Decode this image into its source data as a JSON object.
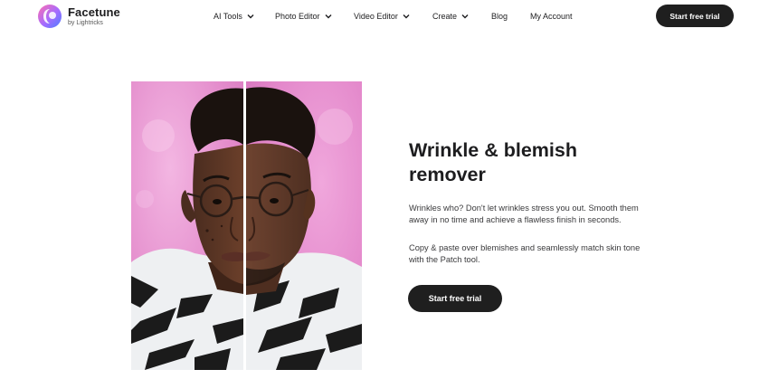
{
  "brand": {
    "name": "Facetune",
    "tagline": "by Lightricks"
  },
  "nav": {
    "items": [
      {
        "label": "AI Tools",
        "has_dropdown": true
      },
      {
        "label": "Photo Editor",
        "has_dropdown": true
      },
      {
        "label": "Video Editor",
        "has_dropdown": true
      },
      {
        "label": "Create",
        "has_dropdown": true
      },
      {
        "label": "Blog",
        "has_dropdown": false
      },
      {
        "label": "My Account",
        "has_dropdown": false
      }
    ],
    "cta_label": "Start free trial"
  },
  "hero": {
    "image_icon": "before-after-portrait-image"
  },
  "feature": {
    "title": "Wrinkle & blemish remover",
    "paragraph_1": "Wrinkles who? Don't let wrinkles stress you out. Smooth them away in no time and achieve a flawless finish in seconds.",
    "paragraph_2": "Copy & paste over blemishes and seamlessly match skin tone with the Patch tool.",
    "cta_label": "Start free trial"
  },
  "colors": {
    "button_bg": "#1f1f1f",
    "button_text": "#ffffff",
    "text_primary": "#1d1d1f",
    "background_pink": "#e58fcc"
  }
}
